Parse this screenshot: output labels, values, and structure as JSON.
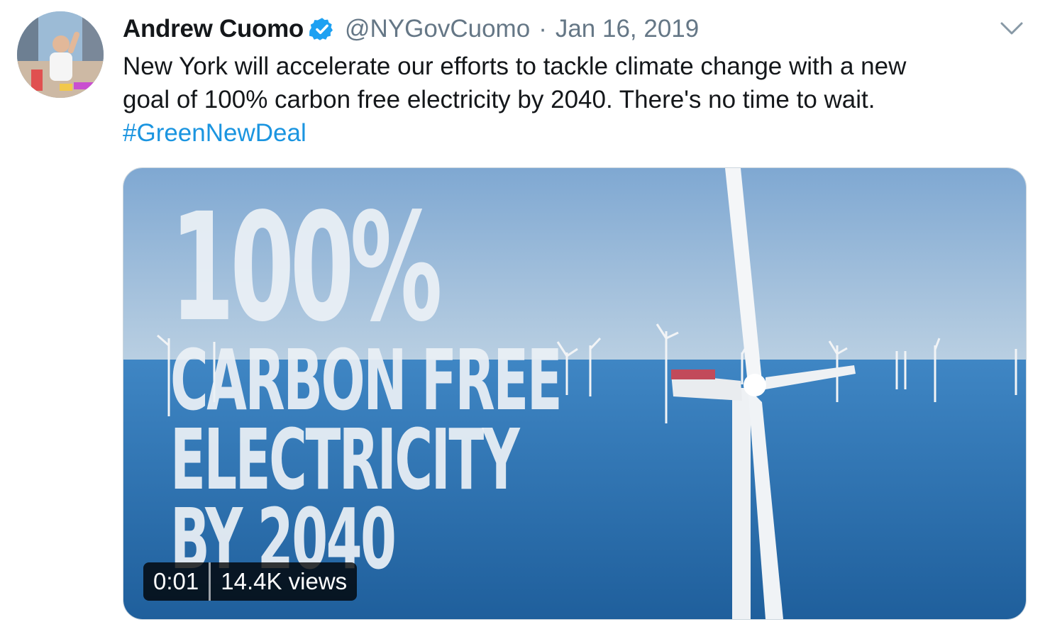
{
  "author": {
    "name": "Andrew Cuomo",
    "handle": "@NYGovCuomo",
    "separator": "·",
    "date": "Jan 16, 2019"
  },
  "tweet": {
    "line1": "New York will accelerate our efforts to tackle climate change with a new",
    "line2": "goal of 100% carbon free electricity by 2040. There's no time to wait.",
    "hashtag": "#GreenNewDeal"
  },
  "video": {
    "overlay": [
      "100%",
      "CARBON FREE",
      "ELECTRICITY",
      "BY 2040"
    ],
    "duration": "0:01",
    "views": "14.4K views"
  },
  "colors": {
    "verified": "#1da1f2",
    "hashtag": "#1b95e0",
    "meta": "#657786"
  },
  "icons": {
    "verified": "verified-badge-icon",
    "menu": "chevron-down-icon"
  }
}
